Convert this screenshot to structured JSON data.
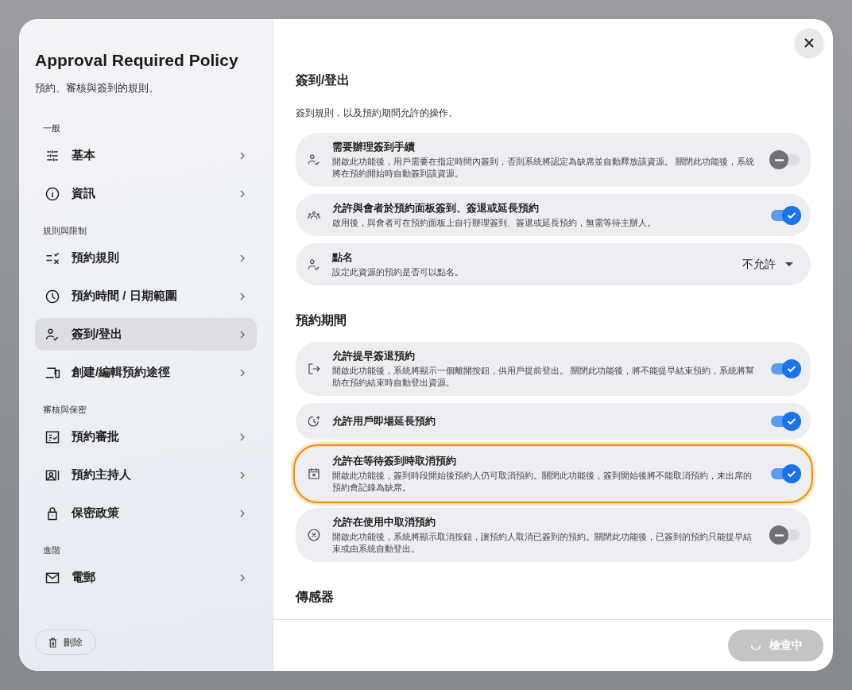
{
  "sidebar": {
    "title": "Approval Required Policy",
    "subtitle": "預約、審核與簽到的規則。",
    "groups": [
      {
        "label": "一般",
        "items": [
          {
            "label": "基本",
            "selected": false
          },
          {
            "label": "資訊",
            "selected": false
          }
        ]
      },
      {
        "label": "規則與限制",
        "items": [
          {
            "label": "預約規則",
            "selected": false
          },
          {
            "label": "預約時間 / 日期範圍",
            "selected": false
          },
          {
            "label": "簽到/登出",
            "selected": true
          },
          {
            "label": "創建/編輯預約途徑",
            "selected": false
          }
        ]
      },
      {
        "label": "審核與保密",
        "items": [
          {
            "label": "預約審批",
            "selected": false
          },
          {
            "label": "預約主持人",
            "selected": false
          },
          {
            "label": "保密政策",
            "selected": false
          }
        ]
      },
      {
        "label": "進階",
        "items": [
          {
            "label": "電郵",
            "selected": false
          }
        ]
      }
    ],
    "delete_button": "刪除"
  },
  "content": {
    "title": "簽到/登出",
    "description": "簽到規則，以及預約期間允許的操作。",
    "sections": [
      {
        "rows": [
          {
            "kind": "toggle",
            "title": "需要辦理簽到手續",
            "description": "開啟此功能後，用戶需要在指定時間內簽到，否則系統將認定為缺席並自動釋放該資源。 關閉此功能後，系統將在預約開始時自動簽到該資源。",
            "on": false,
            "highlighted": false
          },
          {
            "kind": "toggle",
            "title": "允許與會者於預約面板簽到、簽退或延長預約",
            "description": "啟用後，與會者可在預約面板上自行辦理簽到、簽退或延長預約，無需等待主辦人。",
            "on": true,
            "highlighted": false
          },
          {
            "kind": "select",
            "title": "點名",
            "description": "設定此資源的預約是否可以點名。",
            "value": "不允許",
            "highlighted": false
          }
        ]
      },
      {
        "title": "預約期間",
        "rows": [
          {
            "kind": "toggle",
            "title": "允許提早簽退預約",
            "description": "開啟此功能後，系統將顯示一個離開按鈕，供用戶提前登出。 關閉此功能後，將不能提早結束預約，系統將幫助在預約結束時自動登出資源。",
            "on": true,
            "highlighted": false
          },
          {
            "kind": "toggle",
            "title": "允許用戶即場延長預約",
            "on": true,
            "highlighted": false
          },
          {
            "kind": "toggle",
            "title": "允許在等待簽到時取消預約",
            "description": "開啟此功能後，簽到時段開始後預約人仍可取消預約。關閉此功能後，簽到開始後將不能取消預約，未出席的預約會記錄為缺席。",
            "on": true,
            "highlighted": true
          },
          {
            "kind": "toggle",
            "title": "允許在使用中取消預約",
            "description": "開啟此功能後，系統將顯示取消按鈕，讓預約人取消已簽到的預約。關閉此功能後，已簽到的預約只能提早結束或由系統自動登出。",
            "on": false,
            "highlighted": false
          }
        ]
      },
      {
        "title": "傳感器"
      }
    ]
  },
  "footer": {
    "button": "檢查中",
    "loading": true
  }
}
